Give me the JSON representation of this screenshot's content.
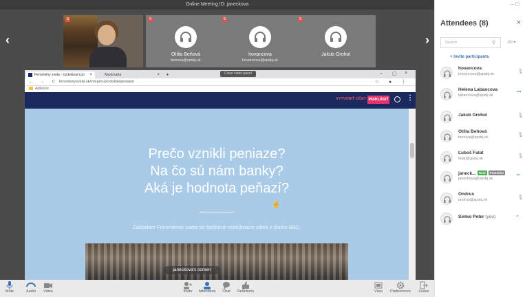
{
  "window": {
    "title": "Online Meeting ID: janeckova",
    "controls": "– ▢ ×"
  },
  "strip": {
    "prev_arrow": "‹",
    "next_arrow": "›",
    "tiles": [
      {
        "badge": "S",
        "name": "",
        "email": ""
      },
      {
        "badge": "S",
        "name": "Otília Beňová",
        "email": "benova@spsbj.sk"
      },
      {
        "badge": "S",
        "name": "hovancova",
        "email": "hovancova@spsbj.sk"
      },
      {
        "badge": "S",
        "name": "Jakub Grohol",
        "email": ""
      }
    ]
  },
  "browser": {
    "tabs": [
      {
        "label": "Fenomény sveta - Vzdelávací po"
      },
      {
        "label": "Nová karta"
      }
    ],
    "close_tab": "×",
    "new_tab": "+",
    "close_video_panel": "Close video panel",
    "win_controls": [
      "–",
      "▢",
      "×"
    ],
    "nav": "← → C",
    "url": "fenomenysveta.sk/vstup/o-produkte/peniaze/",
    "actions": "☆ ● ⋮",
    "bookmark": "Aplikácie"
  },
  "site": {
    "register": "VYTVORIŤ ÚČET",
    "login": "PRIHLÁSIŤ",
    "menu_dots": "⋮",
    "headline": [
      "Prečo vznikli peniaze?",
      "Na čo sú nám banky?",
      "Aká je hodnota peňazí?"
    ],
    "subtitle": "Základom Fenoménov sveta sú špičkové vzdelávacie videá z dielne BBC."
  },
  "screen_label": "janeckova's screen",
  "cursor": "☝",
  "toolbar": {
    "left": [
      {
        "label": "Mute",
        "icon": "microphone-icon"
      },
      {
        "label": "Audio",
        "icon": "headset-icon"
      },
      {
        "label": "Video",
        "icon": "camera-icon"
      }
    ],
    "center": [
      {
        "label": "Invite",
        "icon": "invite-icon"
      },
      {
        "label": "Attendees",
        "icon": "attendees-icon"
      },
      {
        "label": "Chat",
        "icon": "chat-icon"
      },
      {
        "label": "Reactions",
        "icon": "thumbs-up-icon"
      }
    ],
    "right": [
      {
        "label": "View",
        "icon": "view-icon"
      },
      {
        "label": "Preferences",
        "icon": "gear-icon"
      },
      {
        "label": "Leave",
        "icon": "leave-icon"
      }
    ]
  },
  "attendees": {
    "title": "Attendees (8)",
    "close": "×",
    "minimize": "– ▢",
    "search_placeholder": "Search",
    "filter": "All ▾",
    "invite": "+ Invite participants",
    "list": [
      {
        "name": "hovancova",
        "email": "hovancova@spsbj.sk",
        "status": "mic"
      },
      {
        "name": "Helena Labancova",
        "email": "labancova@spsbj.sk",
        "status": "dots"
      },
      {
        "name": "Jakub Grohol",
        "email": "",
        "status": "mic"
      },
      {
        "name": "Otília Beňová",
        "email": "benova@spsbj.sk",
        "status": "mic"
      },
      {
        "name": "Ľuboš Falat",
        "email": "falat@spsbj.sk",
        "status": "mic"
      },
      {
        "name": "janeck...",
        "email": "janeckova@spsbj.sk",
        "status": "dots",
        "host": "Host",
        "presenter": "Presenter"
      },
      {
        "name": "Ondrus",
        "email": "ondrus@spsbj.sk",
        "status": "mic"
      },
      {
        "name": "Simko Peter",
        "you": "(you)",
        "email": "",
        "status": "dot"
      }
    ]
  },
  "colors": {
    "site_header": "#1b2a5e",
    "hero": "#a9cbe8",
    "login": "#e8336a",
    "host_tag": "#4caf50",
    "badge": "#d9534f"
  }
}
